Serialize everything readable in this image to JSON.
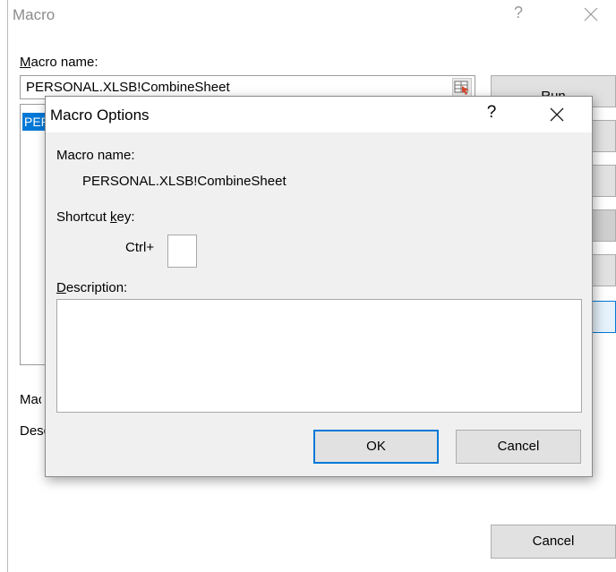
{
  "macro_dialog": {
    "title": "Macro",
    "help_glyph": "?",
    "macro_name_label_accel": "M",
    "macro_name_label_rest": "acro name:",
    "macro_name_value": "PERSONAL.XLSB!CombineSheet",
    "list_item": "PERSONAL.XLSB!CombineSheet",
    "run_label": "Run",
    "macros_in_label": "Macros in:",
    "description_label": "Description",
    "cancel_label": "Cancel"
  },
  "options_dialog": {
    "title": "Macro Options",
    "help_glyph": "?",
    "macro_name_label": "Macro name:",
    "macro_name_value": "PERSONAL.XLSB!CombineSheet",
    "shortcut_label_pre": "Shortcut ",
    "shortcut_label_accel": "k",
    "shortcut_label_post": "ey:",
    "ctrl_label": "Ctrl+",
    "shortcut_value": "",
    "description_label_accel": "D",
    "description_label_rest": "escription:",
    "description_value": "",
    "ok_label": "OK",
    "cancel_label": "Cancel"
  },
  "colors": {
    "selection": "#0078d7",
    "dialog_bg": "#f0f0f0",
    "button_bg": "#e1e1e1"
  }
}
